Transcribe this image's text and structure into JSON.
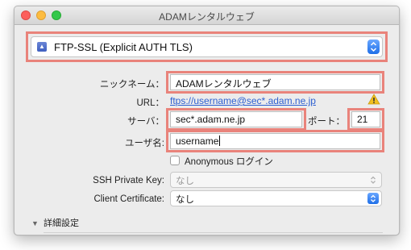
{
  "window": {
    "title": "ADAMレンタルウェブ"
  },
  "protocol": {
    "icon": "ftp-protocol-icon",
    "value": "FTP-SSL (Explicit AUTH TLS)"
  },
  "nickname": {
    "label": "ニックネーム：",
    "value": "ADAMレンタルウェブ"
  },
  "url": {
    "label": "URL：",
    "value": "ftps://username@sec*.adam.ne.jp",
    "warning_icon": "warning-triangle-icon"
  },
  "server": {
    "label": "サーバ：",
    "value": "sec*.adam.ne.jp"
  },
  "port": {
    "label": "ポート：",
    "value": "21"
  },
  "username": {
    "label": "ユーザ名:",
    "value": "username"
  },
  "anonymous": {
    "label": "Anonymous ログイン",
    "checked": false
  },
  "ssh_key": {
    "label": "SSH Private Key:",
    "value": "なし"
  },
  "client_cert": {
    "label": "Client Certificate:",
    "value": "なし"
  },
  "advanced": {
    "label": "詳細設定"
  },
  "colors": {
    "highlight": "#e9837b",
    "accent": "#1f6fe8",
    "link": "#2c5fd1"
  }
}
